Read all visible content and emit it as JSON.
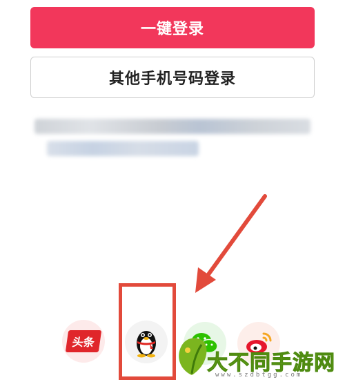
{
  "buttons": {
    "one_click_login": "一键登录",
    "other_phone_login": "其他手机号码登录"
  },
  "login_options": {
    "toutiao_label": "头条"
  },
  "watermark": {
    "title": "大不同手游网",
    "url": "www.szdbtgg.com"
  },
  "colors": {
    "primary": "#f2375b",
    "highlight": "#e24a3b",
    "watermark_green": "#7bb51f"
  },
  "icons": [
    "toutiao-icon",
    "qq-penguin-icon",
    "wechat-icon",
    "weibo-icon",
    "watermark-leaf-icon"
  ]
}
